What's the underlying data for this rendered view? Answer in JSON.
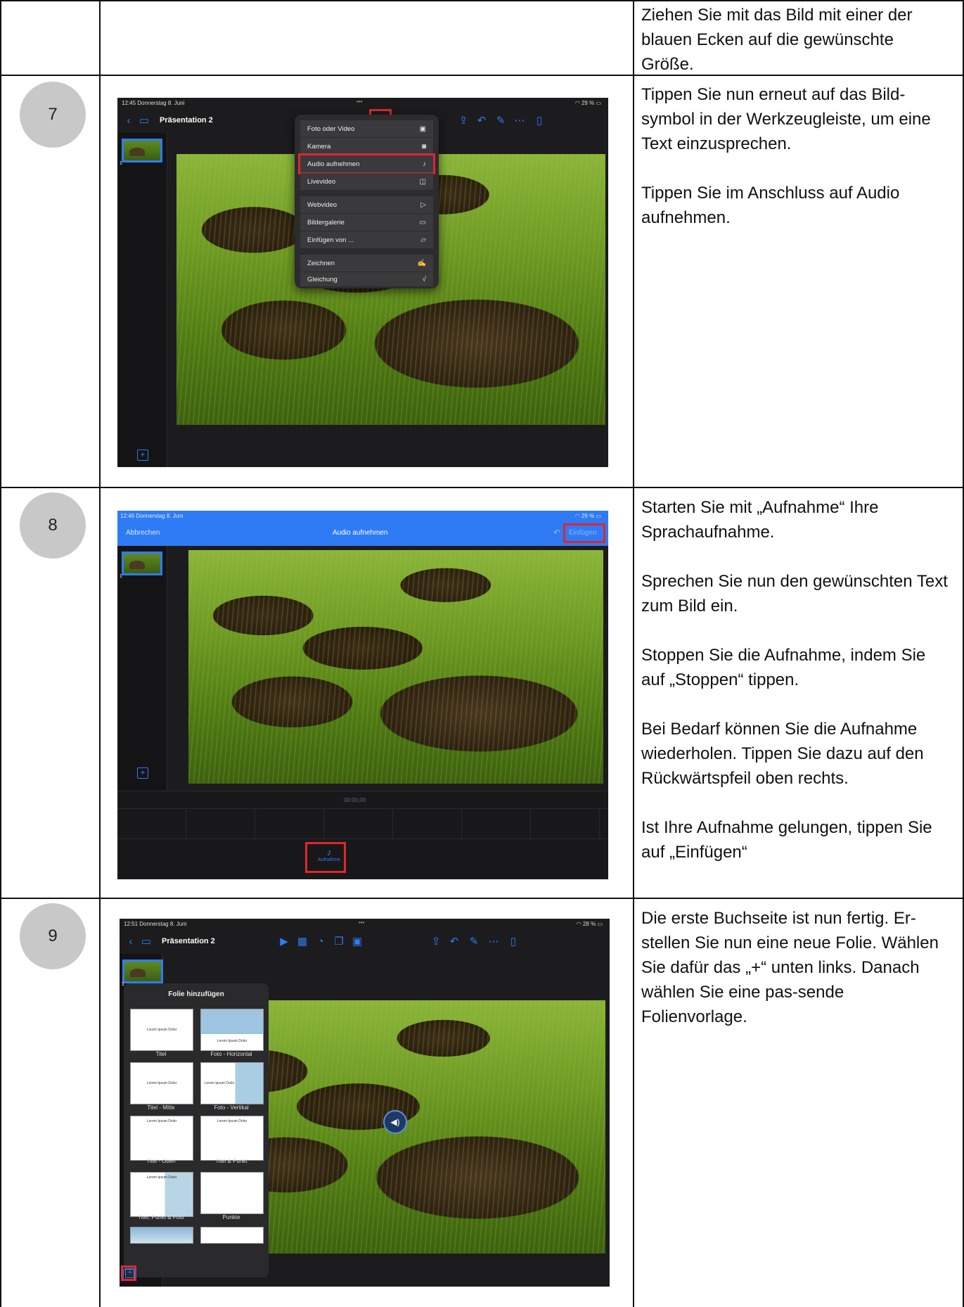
{
  "rows": [
    {
      "number": "",
      "text": [
        "Ziehen Sie mit das Bild mit einer der blauen Ecken auf die gewünschte Größe."
      ]
    },
    {
      "number": "7",
      "text": [
        "Tippen Sie nun erneut auf das Bild-symbol in der Werkzeugleiste, um eine Text einzusprechen.",
        "Tippen Sie im Anschluss auf Audio aufnehmen."
      ]
    },
    {
      "number": "8",
      "text": [
        "Starten Sie mit „Aufnahme“ Ihre Sprachaufnahme.",
        "Sprechen Sie nun den gewünschten Text zum Bild ein.",
        "Stoppen Sie die Aufnahme, indem Sie auf „Stoppen“ tippen.",
        "Bei Bedarf können Sie die Aufnahme wiederholen. Tippen Sie dazu auf den Rückwärtspfeil oben rechts.",
        "Ist Ihre Aufnahme gelungen, tippen Sie auf „Einfügen“"
      ]
    },
    {
      "number": "9",
      "text": [
        "Die erste Buchseite ist nun fertig. Er-stellen Sie nun eine neue Folie. Wählen Sie dafür das „+“ unten links. Danach wählen Sie eine pas-sende Folienvorlage."
      ]
    }
  ],
  "shot7": {
    "time": "12:45  Donnerstag 8. Juni",
    "battery": "29 %",
    "title": "Präsentation 2",
    "slide_number": "1",
    "menu": [
      "Foto oder Video",
      "Kamera",
      "Audio aufnehmen",
      "Livevideo",
      "Webvideo",
      "Bildergalerie",
      "Einfügen von ...",
      "Zeichnen",
      "Gleichung"
    ]
  },
  "shot8": {
    "time": "12:46  Donnerstag 8. Juni",
    "battery": "29 %",
    "cancel": "Abbrechen",
    "title": "Audio aufnehmen",
    "insert": "Einfügen",
    "timer": "00:00,00",
    "record": "Aufnahme",
    "slide_number": "1"
  },
  "shot9": {
    "time": "12:51  Donnerstag 8. Juni",
    "battery": "28 %",
    "title": "Präsentation 2",
    "panel_title": "Folie hinzufügen",
    "slide_number": "1",
    "templates": [
      {
        "label": "Titel",
        "preview": "Lorem Ipsum Dolor"
      },
      {
        "label": "Foto - Horizontal",
        "preview": "Lorem Ipsum Dolor"
      },
      {
        "label": "Titel - Mitte",
        "preview": "Lorem Ipsum Dolor"
      },
      {
        "label": "Foto - Vertikal",
        "preview": "Lorem Ipsum Dolor"
      },
      {
        "label": "Titel - Oben",
        "preview": "Lorem Ipsum Dolor"
      },
      {
        "label": "Titel & Punkt",
        "preview": "Lorem Ipsum Dolor"
      },
      {
        "label": "Titel, Punkt & Foto",
        "preview": "Lorem Ipsum Dolor"
      },
      {
        "label": "Punkte",
        "preview": ""
      }
    ]
  }
}
